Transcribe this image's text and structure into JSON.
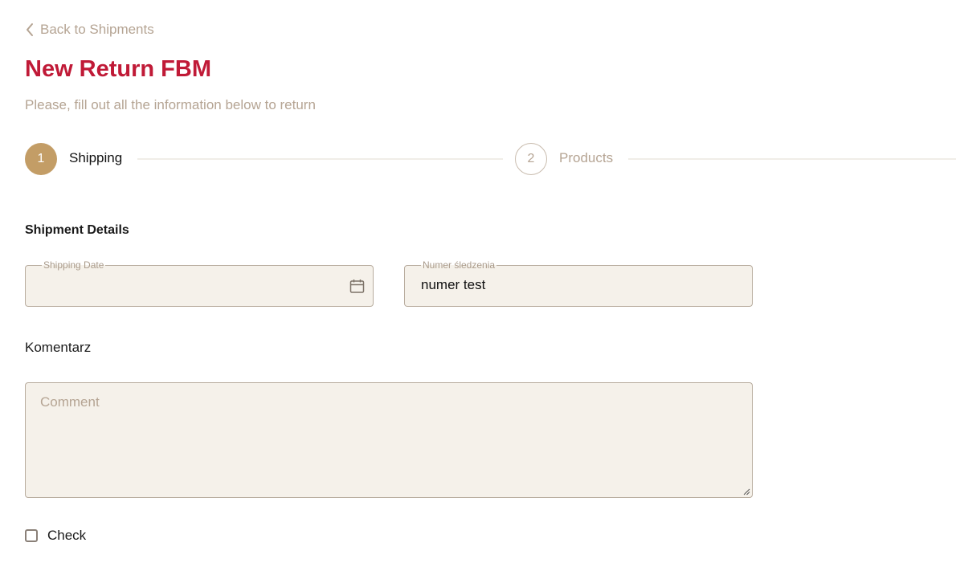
{
  "nav": {
    "back_label": "Back to Shipments",
    "back_icon": "chevron-left-icon"
  },
  "header": {
    "title": "New Return FBM",
    "subtitle": "Please, fill out all the information below to return"
  },
  "stepper": {
    "steps": [
      {
        "number": "1",
        "label": "Shipping",
        "active": true
      },
      {
        "number": "2",
        "label": "Products",
        "active": false
      }
    ]
  },
  "shipment_details": {
    "heading": "Shipment Details",
    "shipping_date": {
      "label": "Shipping Date",
      "value": "",
      "icon": "calendar-icon"
    },
    "tracking_number": {
      "label": "Numer śledzenia",
      "value": "numer test"
    }
  },
  "comment": {
    "heading": "Komentarz",
    "placeholder": "Comment",
    "value": ""
  },
  "check": {
    "label": "Check",
    "checked": false
  },
  "colors": {
    "title": "#c01a37",
    "muted": "#b5a493",
    "accent": "#c39d66",
    "field_bg": "#f5f1ea",
    "field_border": "#b8ac9e"
  }
}
